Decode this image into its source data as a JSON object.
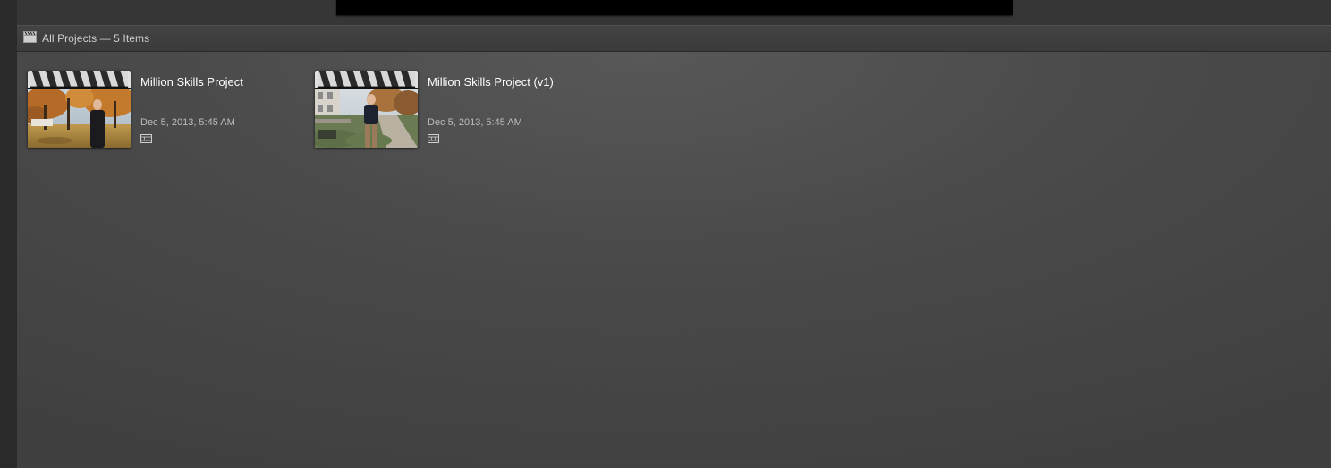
{
  "header": {
    "title": "All Projects — 5 Items",
    "icon": "clapperboard-icon"
  },
  "projects": [
    {
      "name": "Million Skills Project",
      "date": "Dec 5, 2013, 5:45 AM",
      "type_icon": "film-strip-icon",
      "thumbnail": "autumn-trees-person-photo"
    },
    {
      "name": "Million Skills Project (v1)",
      "date": "Dec 5, 2013, 5:45 AM",
      "type_icon": "film-strip-icon",
      "thumbnail": "campus-path-person-photo"
    }
  ],
  "colors": {
    "background": "#4a4a4a",
    "header": "#3f3f3f",
    "text": "#ffffff",
    "secondary_text": "#bdbdbd"
  }
}
